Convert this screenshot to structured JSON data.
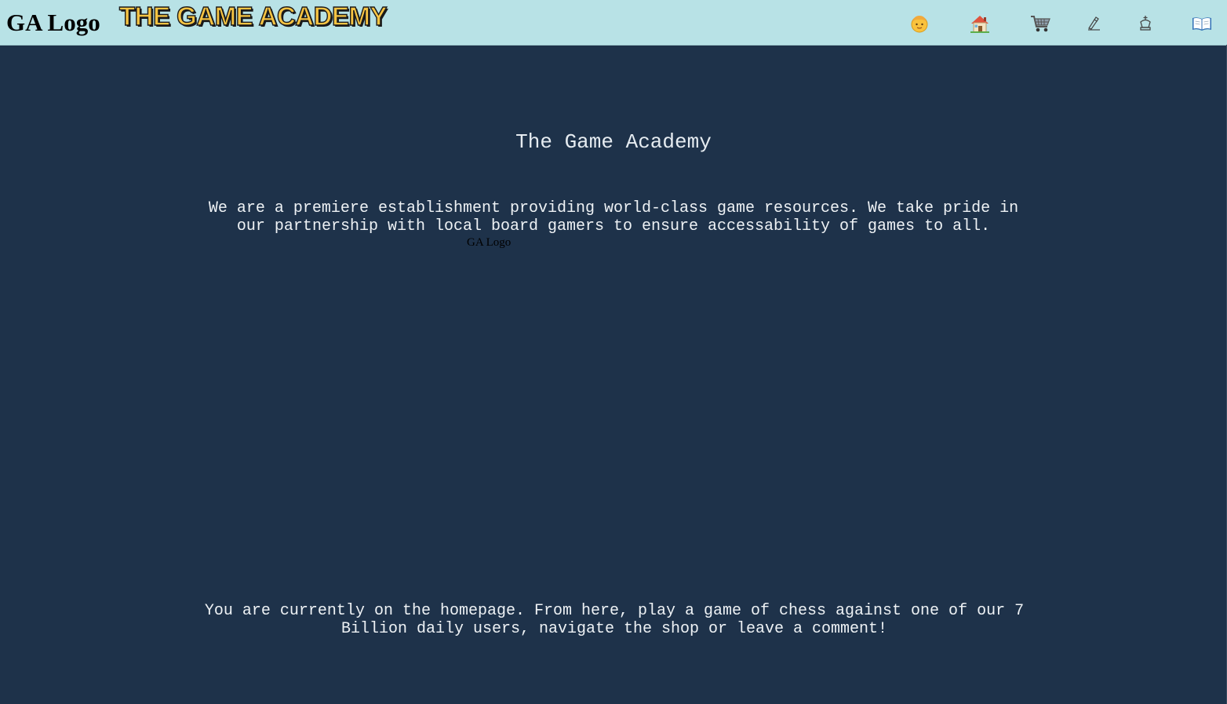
{
  "header": {
    "logo_alt": "GA Logo",
    "brand_title": "THE GAME ACADEMY",
    "nav_icons": [
      "user-face-icon",
      "home-icon",
      "shopping-cart-icon",
      "writing-hand-icon",
      "chess-king-icon",
      "open-book-icon"
    ]
  },
  "main": {
    "heading": "The Game Academy",
    "intro_text": "We are a premiere establishment providing world-class game resources. We take pride in our partnership with local board gamers to ensure accessability of games to all.",
    "image_alt": "GA Logo",
    "homepage_note": "You are currently on the homepage. From here, play a game of chess against one of our 7 Billion daily users, navigate the shop or leave a comment!"
  },
  "colors": {
    "header_bg": "#b8e2e6",
    "page_bg": "#1e324a",
    "brand_text": "#f7c443",
    "body_text": "#eef2f5"
  }
}
